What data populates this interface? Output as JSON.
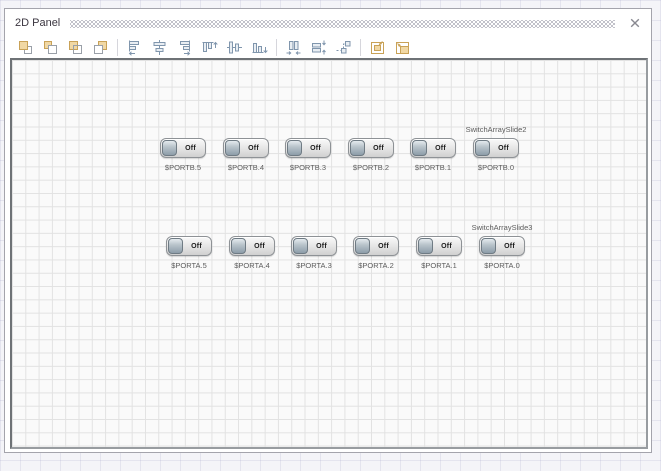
{
  "window": {
    "title": "2D Panel"
  },
  "toolbar": {
    "icons": [
      "bring-to-front",
      "send-to-back",
      "bring-forward",
      "send-backward",
      "align-left",
      "align-center",
      "align-right",
      "align-top",
      "align-middle",
      "align-bottom",
      "space-across",
      "space-down",
      "snap-to-grid",
      "fit-panel",
      "resize-panel"
    ]
  },
  "canvas": {
    "rows": [
      {
        "caption": "SwitchArraySlide2",
        "switches": [
          {
            "label": "$PORTB.5",
            "state": "Off"
          },
          {
            "label": "$PORTB.4",
            "state": "Off"
          },
          {
            "label": "$PORTB.3",
            "state": "Off"
          },
          {
            "label": "$PORTB.2",
            "state": "Off"
          },
          {
            "label": "$PORTB.1",
            "state": "Off"
          },
          {
            "label": "$PORTB.0",
            "state": "Off"
          }
        ]
      },
      {
        "caption": "SwitchArraySlide3",
        "switches": [
          {
            "label": "$PORTA.5",
            "state": "Off"
          },
          {
            "label": "$PORTA.4",
            "state": "Off"
          },
          {
            "label": "$PORTA.3",
            "state": "Off"
          },
          {
            "label": "$PORTA.2",
            "state": "Off"
          },
          {
            "label": "$PORTA.1",
            "state": "Off"
          },
          {
            "label": "$PORTA.0",
            "state": "Off"
          }
        ]
      }
    ]
  },
  "colors": {
    "accent_tan": "#f1d8a4",
    "accent_tan_border": "#c9a257",
    "accent_blue": "#8096ad",
    "grid_line": "#e2e2e2",
    "switch_knob": "#9fb0ba",
    "title_text": "#3b3640"
  }
}
